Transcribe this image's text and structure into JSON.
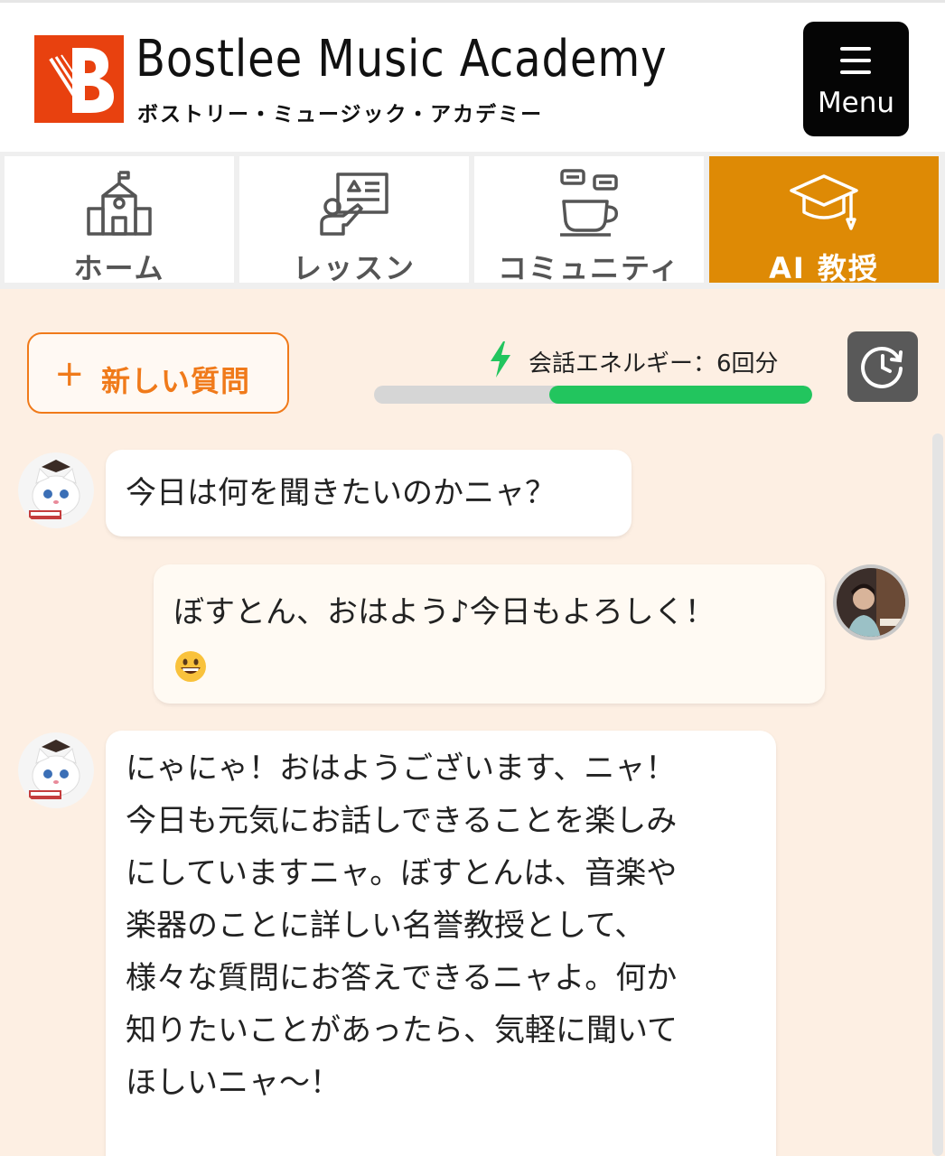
{
  "brand": {
    "title": "Bostlee Music Academy",
    "subtitle": "ボストリー・ミュージック・アカデミー",
    "logo_color": "#e8410f"
  },
  "menu_button": {
    "label": "Menu",
    "icon": "hamburger-icon"
  },
  "nav": {
    "tabs": [
      {
        "label": "ホーム",
        "icon": "school-building-icon",
        "active": false
      },
      {
        "label": "レッスン",
        "icon": "lesson-board-icon",
        "active": false
      },
      {
        "label": "コミュニティ",
        "icon": "coffee-chat-icon",
        "active": false
      },
      {
        "label": "AI 教授",
        "icon": "graduation-cap-icon",
        "active": true
      }
    ],
    "active_color": "#de8a05"
  },
  "toolbar": {
    "new_question_label": "新しい質問",
    "energy_label": "会話エネルギー：",
    "energy_value": "6回分",
    "energy_level": 0.6,
    "energy_color": "#22c55e",
    "history_icon": "history-clock-icon"
  },
  "messages": [
    {
      "sender": "ai",
      "avatar": "cat-professor-avatar",
      "lines": [
        "今日は何を聞きたいのかニャ？"
      ]
    },
    {
      "sender": "user",
      "avatar": "user-photo-avatar",
      "lines": [
        "ぼすとん、おはよう♪今日もよろしく！"
      ],
      "emoji": "grinning-face-emoji"
    },
    {
      "sender": "ai",
      "avatar": "cat-professor-avatar",
      "lines": [
        "にゃにゃ！おはようございます、ニャ！",
        "今日も元気にお話しできることを楽しみ",
        "にしていますニャ。ぼすとんは、音楽や",
        "楽器のことに詳しい名誉教授として、",
        "様々な質問にお答えできるニャよ。何か",
        "知りたいことがあったら、気軽に聞いて",
        "ほしいニャ〜！"
      ]
    }
  ]
}
